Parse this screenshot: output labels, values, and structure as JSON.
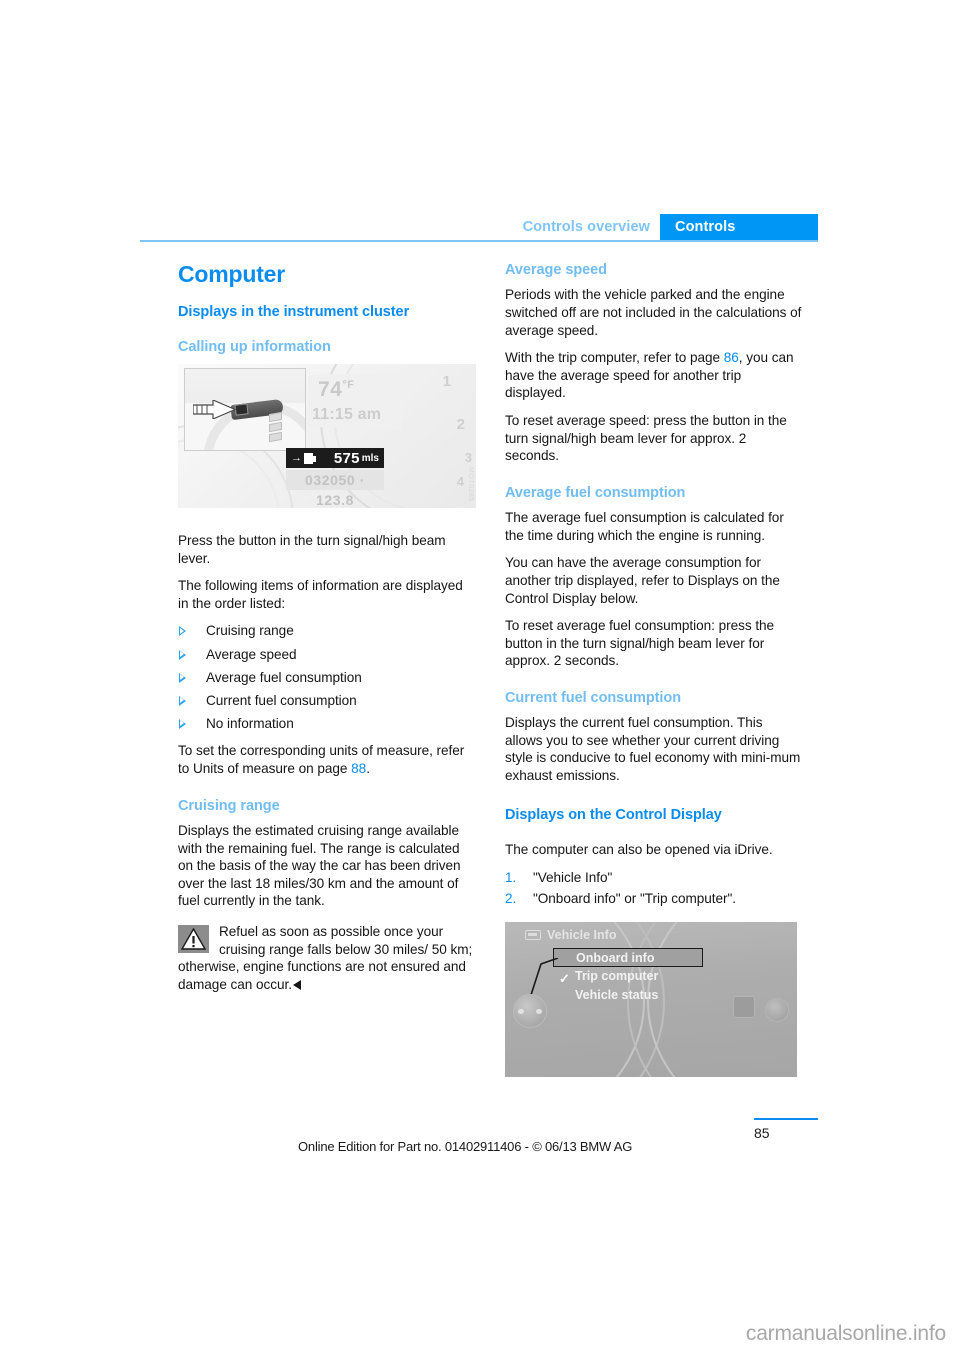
{
  "header": {
    "tab_inactive": "Controls overview",
    "tab_active": "Controls",
    "accent_blue": "#0096f5",
    "light_blue": "#7fc4f7"
  },
  "left_column": {
    "title": "Computer",
    "section_heading": "Displays in the instrument cluster",
    "sub1": "Calling up information",
    "figure_cluster": {
      "name": "instrument-cluster-photo",
      "temperature": "74",
      "temperature_unit": "°F",
      "time": "11:15 am",
      "range_value": "575",
      "range_unit": "mls",
      "odometer": "032050 · 123.8",
      "dial_number_1": "1",
      "dial_number_2": "2",
      "dial_number_3": "3",
      "dial_number_4": "4",
      "watermark": "MOT0285"
    },
    "p1": "Press the button in the turn signal/high beam lever.",
    "p2": "The following items of information are displayed in the order listed:",
    "bullets": [
      "Cruising range",
      "Average speed",
      "Average fuel consumption",
      "Current fuel consumption",
      "No information"
    ],
    "p3_pre": "To set the corresponding units of measure, refer to Units of measure on page ",
    "p3_ref": "88",
    "p3_post": ".",
    "sub2": "Cruising range",
    "p4": "Displays the estimated cruising range available with the remaining fuel. The range is calculated on the basis of the way the car has been driven over the last 18 miles/30 km and the amount of fuel currently in the tank.",
    "note": "Refuel as soon as possible once your cruising range falls below 30 miles/ 50 km; otherwise, engine functions are not ensured and damage can occur."
  },
  "right_column": {
    "sub1": "Average speed",
    "p1": "Periods with the vehicle parked and the engine switched off are not included in the calculations of average speed.",
    "p2_pre": "With the trip computer, refer to page ",
    "p2_ref": "86",
    "p2_post": ", you can have the average speed for another trip displayed.",
    "p3": "To reset average speed: press the button in the turn signal/high beam lever for approx. 2 seconds.",
    "sub2": "Average fuel consumption",
    "p4": "The average fuel consumption is calculated for the time during which the engine is running.",
    "p5": "You can have the average consumption for another trip displayed, refer to Displays on the Control Display below.",
    "p6": "To reset average fuel consumption: press the button in the turn signal/high beam lever for approx. 2 seconds.",
    "sub3": "Current fuel consumption",
    "p7": "Displays the current fuel consumption. This allows you to see whether your current driving style is conducive to fuel economy with mini-mum exhaust emissions.",
    "section_heading": "Displays on the Control Display",
    "p8": "The computer can also be opened via iDrive.",
    "steps": [
      {
        "num": "1.",
        "text": "\"Vehicle Info\""
      },
      {
        "num": "2.",
        "text": "\"Onboard info\" or \"Trip computer\"."
      }
    ],
    "figure_control_display": {
      "name": "control-display-photo",
      "title": "Vehicle Info",
      "items": [
        {
          "label": "Onboard info",
          "selected": true,
          "checked": false
        },
        {
          "label": "Trip computer",
          "selected": false,
          "checked": true
        },
        {
          "label": "Vehicle status",
          "selected": false,
          "checked": false
        }
      ]
    }
  },
  "footer": {
    "edition_text": "Online Edition for Part no. 01402911406 - © 06/13 BMW AG",
    "page_number": "85"
  },
  "watermark": "carmanualsonline.info"
}
